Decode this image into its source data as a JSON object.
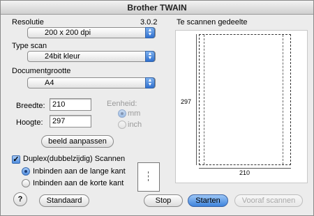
{
  "window": {
    "title": "Brother TWAIN"
  },
  "resolution": {
    "label": "Resolutie",
    "value": "200 x 200 dpi",
    "version": "3.0.2"
  },
  "scan_type": {
    "label": "Type scan",
    "value": "24bit kleur"
  },
  "document_size": {
    "label": "Documentgrootte",
    "value": "A4"
  },
  "width": {
    "label": "Breedte:",
    "value": "210"
  },
  "height": {
    "label": "Hoogte:",
    "value": "297"
  },
  "unit": {
    "label": "Eenheid:",
    "options": [
      "mm",
      "inch"
    ],
    "selected": "mm",
    "disabled": true
  },
  "fit_button": "beeld aanpassen",
  "duplex": {
    "label": "Duplex(dubbelzijdig) Scannen",
    "checked": true,
    "options": [
      "Inbinden aan de lange kant",
      "Inbinden aan de korte kant"
    ],
    "selected": "Inbinden aan de lange kant"
  },
  "preview": {
    "label": "Te scannen gedeelte",
    "height_value": "297",
    "width_value": "210"
  },
  "buttons": {
    "help": "?",
    "default": "Standaard",
    "stop": "Stop",
    "start": "Starten",
    "prescan": "Vooraf scannen"
  }
}
